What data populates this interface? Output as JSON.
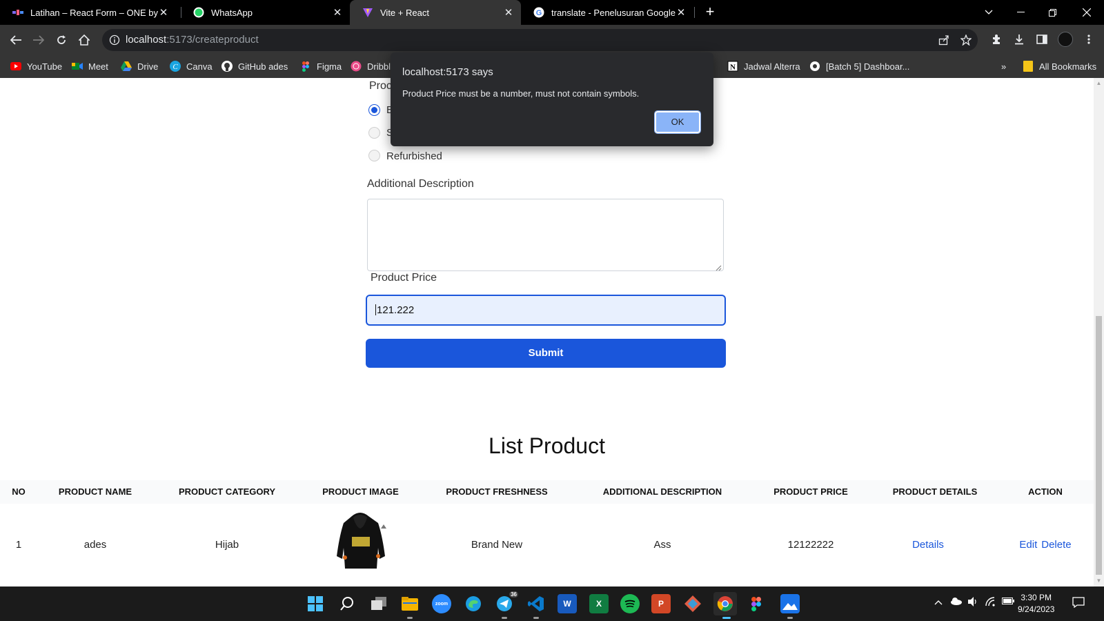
{
  "browser": {
    "tabs": [
      {
        "title": "Latihan – React Form – ONE by /",
        "icon": "alterra-icon"
      },
      {
        "title": "WhatsApp",
        "icon": "whatsapp-icon"
      },
      {
        "title": "Vite + React",
        "icon": "vite-icon"
      },
      {
        "title": "translate - Penelusuran Google",
        "icon": "google-icon"
      }
    ],
    "url_host": "localhost",
    "url_path": ":5173/createproduct",
    "bookmarks": [
      {
        "label": "YouTube",
        "icon": "youtube-icon"
      },
      {
        "label": "Meet",
        "icon": "meet-icon"
      },
      {
        "label": "Drive",
        "icon": "drive-icon"
      },
      {
        "label": "Canva",
        "icon": "canva-icon"
      },
      {
        "label": "GitHub ades",
        "icon": "github-icon"
      },
      {
        "label": "Figma",
        "icon": "figma-icon"
      },
      {
        "label": "Dribbl",
        "icon": "dribbble-icon"
      },
      {
        "label": "Jadwal Alterra",
        "icon": "notion-icon"
      },
      {
        "label": "[Batch 5] Dashboar...",
        "icon": "globe-icon"
      }
    ],
    "bookmarks_overflow": "»",
    "all_bookmarks": "All Bookmarks"
  },
  "form": {
    "freshness_label_partial": "Proc",
    "radio_options": [
      {
        "label": "B",
        "checked": true
      },
      {
        "label": "S",
        "checked": false
      },
      {
        "label": "Refurbished",
        "checked": false
      }
    ],
    "additional_description_label": "Additional Description",
    "additional_description_value": "",
    "price_label": "Product Price",
    "price_value": "121.222",
    "submit_label": "Submit"
  },
  "list": {
    "title": "List Product",
    "headers": [
      "No",
      "Product Name",
      "Product Category",
      "Product Image",
      "Product Freshness",
      "Additional Description",
      "Product Price",
      "Product Details",
      "Action"
    ],
    "rows": [
      {
        "no": "1",
        "name": "ades",
        "category": "Hijab",
        "image": "hoodie-image",
        "freshness": "Brand New",
        "description": "Ass",
        "price": "12122222",
        "details": "Details",
        "edit": "Edit",
        "delete": "Delete"
      }
    ]
  },
  "dialog": {
    "title": "localhost:5173 says",
    "message": "Product Price must be a number, must not contain symbols.",
    "ok_label": "OK"
  },
  "taskbar": {
    "telegram_badge": "36",
    "time": "3:30 PM",
    "date": "9/24/2023"
  },
  "colors": {
    "primary": "#1a56db",
    "edit": "#0e7a3e",
    "delete": "#d61f1f"
  }
}
